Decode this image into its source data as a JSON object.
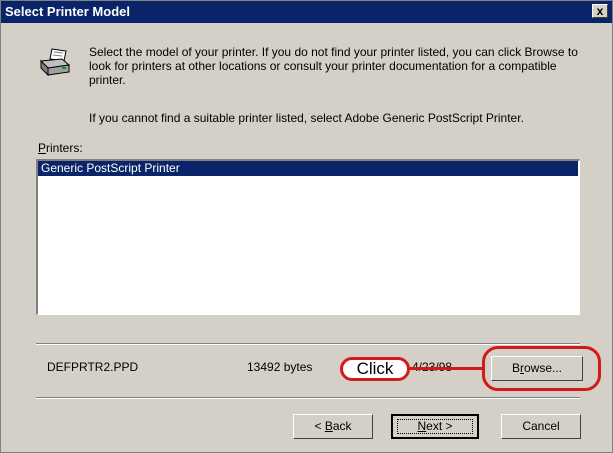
{
  "window": {
    "title": "Select Printer Model",
    "close_glyph": "x"
  },
  "icons": {
    "printer": "printer-icon",
    "close": "close-icon"
  },
  "intro_text": "Select the model of your printer. If you do not find your printer listed, you can click Browse to look for printers at other locations or consult your printer documentation for a compatible printer.",
  "secondary_text": "If you cannot find a suitable printer listed, select Adobe Generic PostScript Printer.",
  "printers": {
    "label_mnemonic": "P",
    "label_rest": "rinters:",
    "items": [
      {
        "name": "Generic PostScript Printer",
        "selected": true
      }
    ]
  },
  "file_info": {
    "name": "DEFPRTR2.PPD",
    "size": "13492 bytes",
    "date_partial": "4/23/98"
  },
  "buttons": {
    "browse": {
      "mnemonic": "r",
      "prefix": "B",
      "suffix": "owse..."
    },
    "back": {
      "prefix": "< ",
      "mnemonic": "B",
      "suffix": "ack"
    },
    "next": {
      "mnemonic": "N",
      "suffix": "ext >"
    },
    "cancel": {
      "label": "Cancel"
    }
  },
  "callout": {
    "label": "Click",
    "color": "#d21a1a"
  },
  "colors": {
    "titlebar": "#0a246a",
    "selection": "#0a246a",
    "face": "#d4d0c8",
    "callout": "#d21a1a"
  }
}
